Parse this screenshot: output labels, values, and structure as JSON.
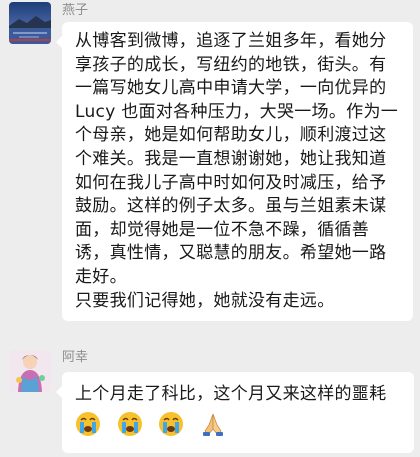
{
  "messages": [
    {
      "sender": "燕子",
      "avatar_icon": "lake-landscape-avatar",
      "paragraphs": [
        "从博客到微博，追逐了兰姐多年，看她分享孩子的成长，写纽约的地铁，街头。有一篇写她女儿高中申请大学，一向优异的Lucy 也面对各种压力，大哭一场。作为一个母亲，她是如何帮助女儿，顺利渡过这个难关。我是一直想谢谢她，她让我知道如何在我儿子高中时如何及时减压，给予鼓励。这样的例子太多。虽与兰姐素未谋面，却觉得她是一位不急不躁，循循善诱，真性情，又聪慧的朋友。希望她一路走好。",
        "只要我们记得她，她就没有走远。"
      ]
    },
    {
      "sender": "阿幸",
      "avatar_icon": "colorful-figure-avatar",
      "text": "上个月走了科比，这个月又来这样的噩耗",
      "emojis": [
        "crying-face-icon",
        "crying-face-icon",
        "crying-face-icon",
        "praying-hands-icon"
      ]
    }
  ],
  "colors": {
    "background": "#ededed",
    "bubble": "#ffffff",
    "name": "#8d8d8d",
    "text": "#191919"
  }
}
